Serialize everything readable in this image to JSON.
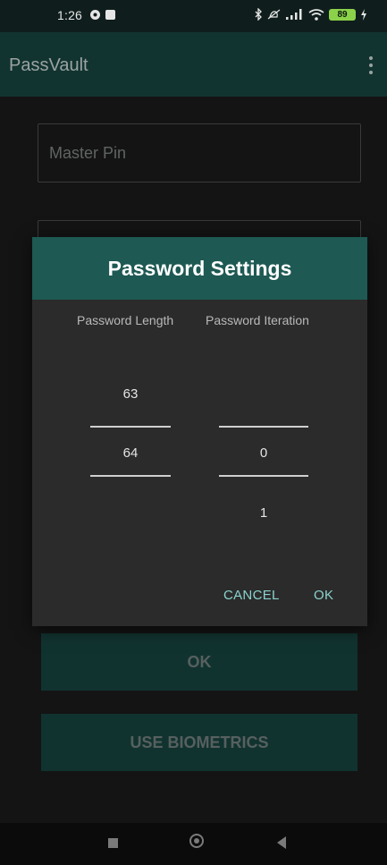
{
  "status_bar": {
    "time": "1:26",
    "battery": "89",
    "icons": [
      "vpn-key-icon",
      "notification-icon",
      "bluetooth-icon",
      "mute-icon",
      "signal-icon",
      "wifi-icon",
      "battery-icon",
      "charging-icon"
    ]
  },
  "app_bar": {
    "title": "PassVault",
    "menu_icon": "overflow-menu-icon"
  },
  "form": {
    "pin_placeholder": "Master Pin",
    "ok_label": "OK",
    "biometrics_label": "USE BIOMETRICS"
  },
  "dialog": {
    "title": "Password Settings",
    "length_label": "Password Length",
    "iteration_label": "Password Iteration",
    "length_picker": {
      "above": "63",
      "selected": "64"
    },
    "iteration_picker": {
      "selected": "0",
      "below": "1"
    },
    "cancel_label": "CANCEL",
    "ok_label": "OK"
  },
  "colors": {
    "accent": "#1e5953",
    "action_text": "#8ad3cd",
    "app_bar": "#123431"
  }
}
